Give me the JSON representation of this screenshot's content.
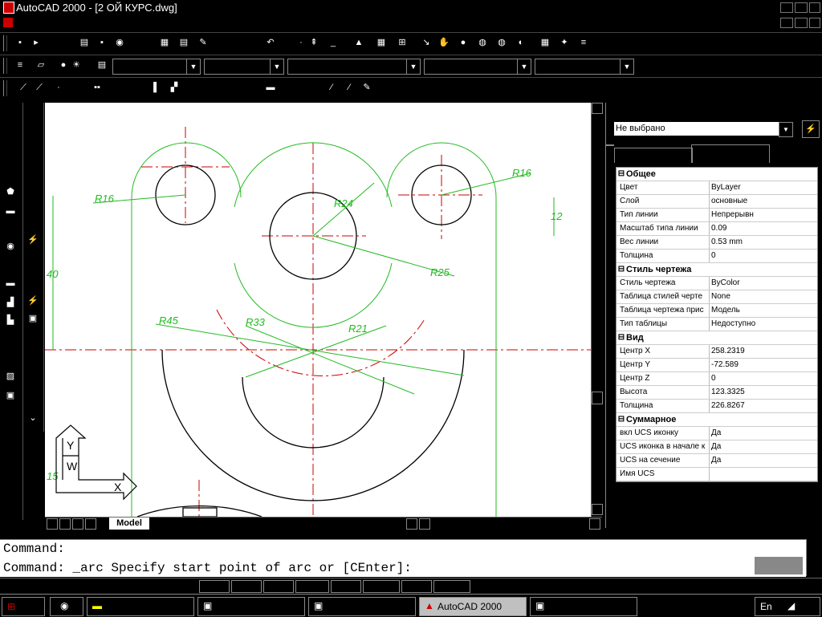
{
  "window": {
    "title": "AutoCAD 2000 - [2 ОЙ КУРС.dwg]"
  },
  "properties": {
    "selection": "Не выбрано",
    "categories": [
      {
        "name": "Общее",
        "rows": [
          {
            "name": "Цвет",
            "value": "ByLayer"
          },
          {
            "name": "Слой",
            "value": "основные"
          },
          {
            "name": "Тип линии",
            "value": "Непрерывн"
          },
          {
            "name": "Масштаб типа линии",
            "value": "0.09"
          },
          {
            "name": "Вес линии",
            "value": "0.53 mm"
          },
          {
            "name": "Толщина",
            "value": "0"
          }
        ]
      },
      {
        "name": "Стиль чертежа",
        "rows": [
          {
            "name": "Стиль чертежа",
            "value": "ByColor"
          },
          {
            "name": "Таблица стилей черте",
            "value": "None"
          },
          {
            "name": "Таблица чертежа прис",
            "value": "Модель"
          },
          {
            "name": "Тип таблицы",
            "value": "Недоступно"
          }
        ]
      },
      {
        "name": "Вид",
        "rows": [
          {
            "name": "Центр X",
            "value": "258.2319"
          },
          {
            "name": "Центр Y",
            "value": "-72.589"
          },
          {
            "name": "Центр Z",
            "value": "0"
          },
          {
            "name": "Высота",
            "value": "123.3325"
          },
          {
            "name": "Толщина",
            "value": "226.8267"
          }
        ]
      },
      {
        "name": "Суммарное",
        "rows": [
          {
            "name": "вкл UCS иконку",
            "value": "Да"
          },
          {
            "name": "UCS иконка в начале к",
            "value": "Да"
          },
          {
            "name": "UCS на сечение",
            "value": "Да"
          },
          {
            "name": "Имя UCS",
            "value": ""
          }
        ]
      }
    ]
  },
  "drawing": {
    "model_tab": "Model",
    "dimensions": {
      "r16_left": "R16",
      "r16_right": "R16",
      "r24": "R24",
      "r25": "R25",
      "r45": "R45",
      "r33": "R33",
      "r21": "R21",
      "d12": "12",
      "d40": "40",
      "d15": "15"
    },
    "ucs": {
      "x": "X",
      "y": "Y",
      "w": "W"
    },
    "colors": {
      "green": "#22bb22",
      "red": "#cc0000",
      "black": "#000000"
    }
  },
  "command": {
    "line1": "Command:",
    "line2": "Command: _arc Specify start point of arc or [CEnter]:"
  },
  "taskbar": {
    "active_task": "AutoCAD 2000",
    "lang": "En"
  }
}
